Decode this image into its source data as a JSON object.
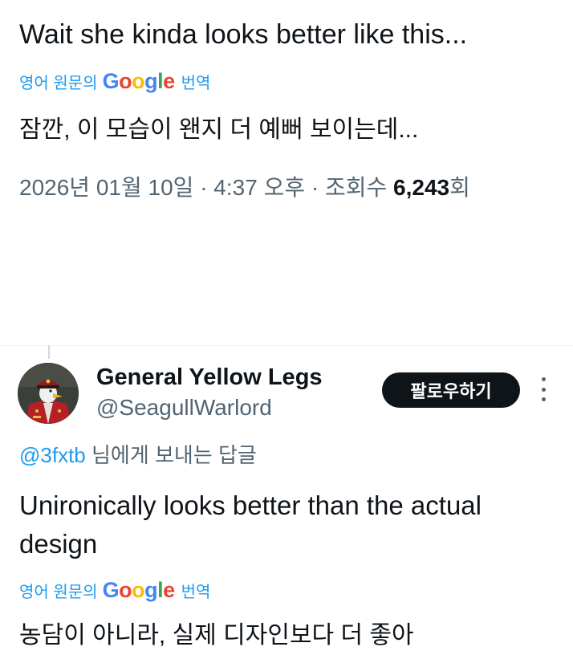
{
  "main_tweet": {
    "text": "Wait she kinda looks better like this...",
    "translate_prefix": "영어 원문의",
    "google_letters": [
      "G",
      "o",
      "o",
      "g",
      "l",
      "e"
    ],
    "translate_suffix": "번역",
    "translated_text": "잠깐, 이 모습이 왠지 더 예뻐 보이는데...",
    "timestamp": "2026년 01월 10일 · 4:37 오후 · 조회수 ",
    "view_count": "6,243",
    "view_suffix": "회"
  },
  "reply": {
    "display_name": "General Yellow Legs",
    "handle": "@SeagullWarlord",
    "follow_label": "팔로우하기",
    "reply_to_handle": "@3fxtb",
    "reply_to_suffix": " 님에게 보내는 답글",
    "text": "Unironically looks better than the actual design",
    "translate_prefix": "영어 원문의",
    "google_letters": [
      "G",
      "o",
      "o",
      "g",
      "l",
      "e"
    ],
    "translate_suffix": "번역",
    "translated_text": "농담이 아니라, 실제 디자인보다 더 좋아"
  },
  "icons": {
    "more": "more-vertical-icon",
    "avatar": "avatar-seagull-general"
  },
  "colors": {
    "text_primary": "#0f1419",
    "text_secondary": "#536471",
    "link_blue": "#1d9bf0",
    "google_blue": "#4285f4",
    "google_red": "#ea4335",
    "google_yellow": "#fbbc05",
    "google_green": "#34a853",
    "follow_bg": "#0f1419",
    "follow_text": "#ffffff"
  }
}
